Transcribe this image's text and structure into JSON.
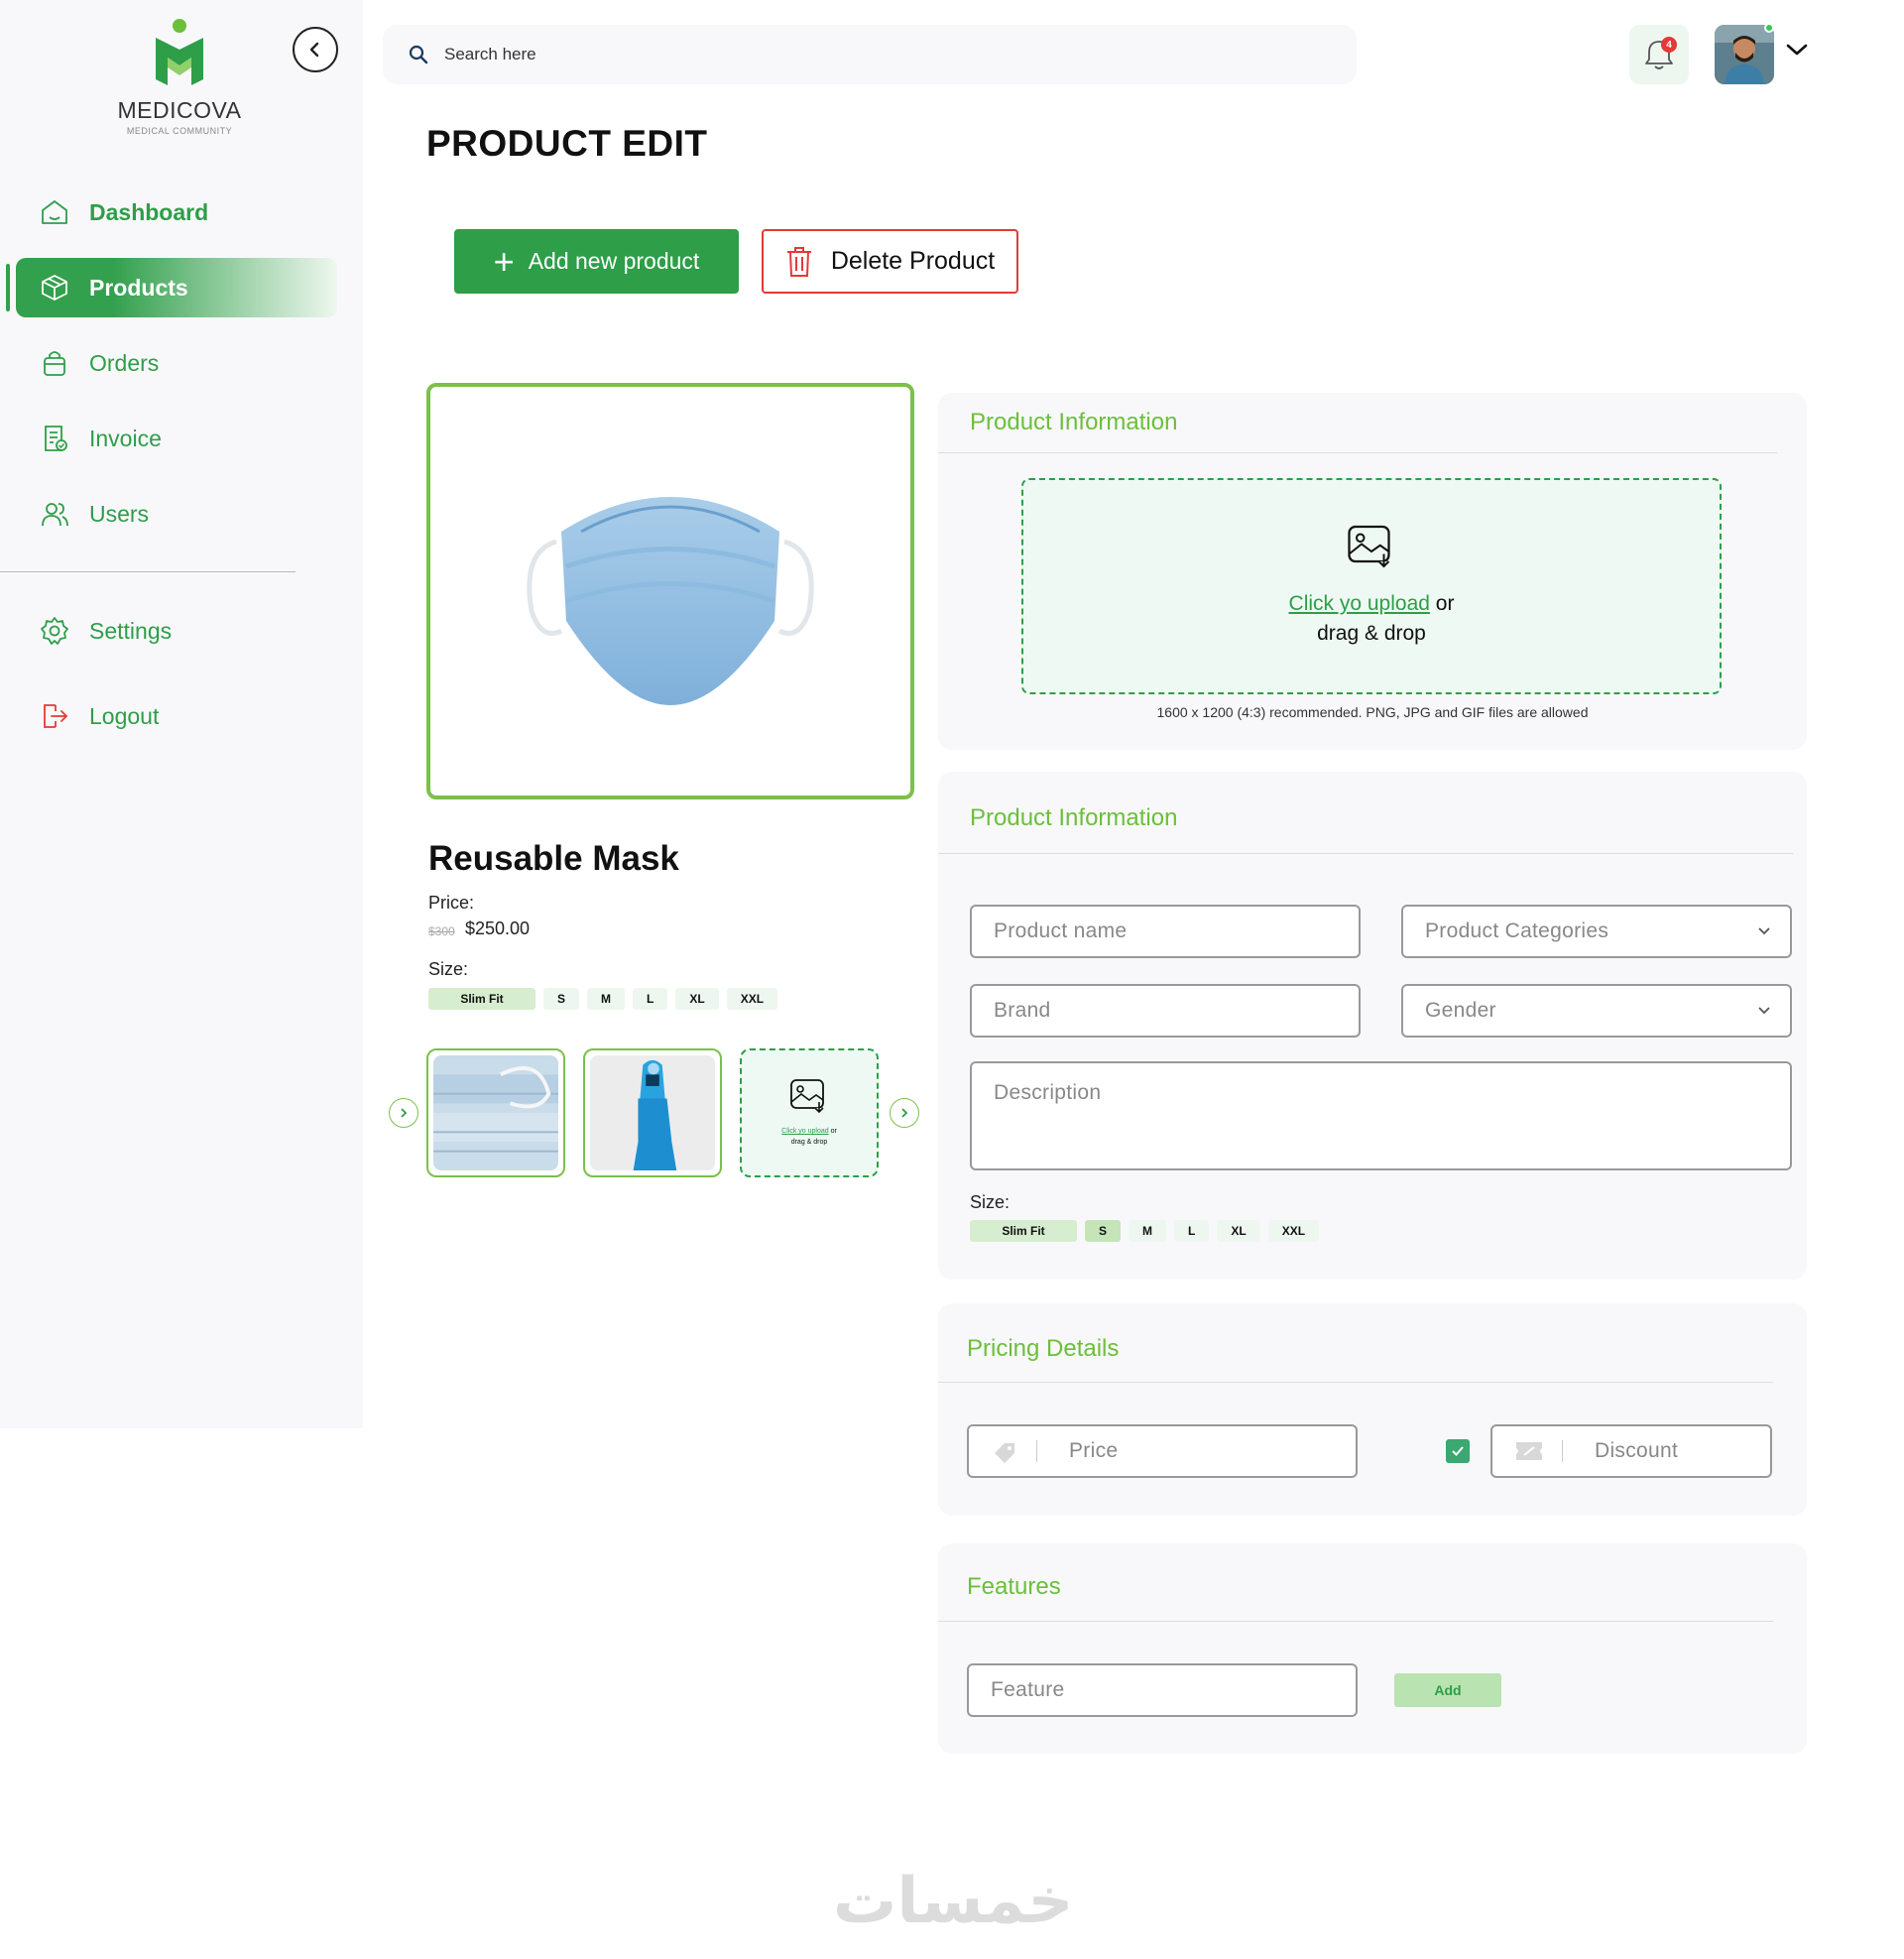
{
  "app": {
    "brand": "MEDICOVA",
    "tagline": "MEDICAL COMMUNITY",
    "accent": "#2e9e48",
    "accent_light": "#6bbf3b",
    "danger": "#e53935"
  },
  "sidebar": {
    "items": [
      {
        "label": "Dashboard",
        "icon": "home-icon"
      },
      {
        "label": "Products",
        "icon": "box-icon",
        "active": true
      },
      {
        "label": "Orders",
        "icon": "shopping-bag-icon"
      },
      {
        "label": "Invoice",
        "icon": "invoice-icon"
      },
      {
        "label": "Users",
        "icon": "users-icon"
      },
      {
        "label": "Settings",
        "icon": "gear-icon"
      },
      {
        "label": "Logout",
        "icon": "logout-icon"
      }
    ]
  },
  "header": {
    "search_placeholder": "Search here",
    "notification_count": "4"
  },
  "page": {
    "title": "PRODUCT EDIT",
    "add_button": "Add new product",
    "delete_button": "Delete Product"
  },
  "product": {
    "name": "Reusable Mask",
    "price_label": "Price:",
    "old_price": "$300",
    "price": "$250.00",
    "size_label": "Size:",
    "sizes": [
      "Slim Fit",
      "S",
      "M",
      "L",
      "XL",
      "XXL"
    ],
    "upload_link": "Click yo upload",
    "upload_or": "or",
    "upload_drag": "drag & drop"
  },
  "upload_card": {
    "title": "Product Information",
    "upload_link": "Click yo upload",
    "upload_or": "or",
    "upload_drag": "drag & drop",
    "hint": "1600 x 1200 (4:3) recommended. PNG, JPG and GIF files are allowed"
  },
  "info_card": {
    "title": "Product Information",
    "product_name": "Product name",
    "categories": "Product Categories",
    "brand": "Brand",
    "gender": "Gender",
    "description": "Description",
    "size_label": "Size:",
    "sizes": [
      "Slim Fit",
      "S",
      "M",
      "L",
      "XL",
      "XXL"
    ]
  },
  "pricing_card": {
    "title": "Pricing Details",
    "price": "Price",
    "discount": "Discount",
    "discount_enabled": true
  },
  "features_card": {
    "title": "Features",
    "feature": "Feature",
    "add": "Add"
  },
  "watermark": "خمسات"
}
